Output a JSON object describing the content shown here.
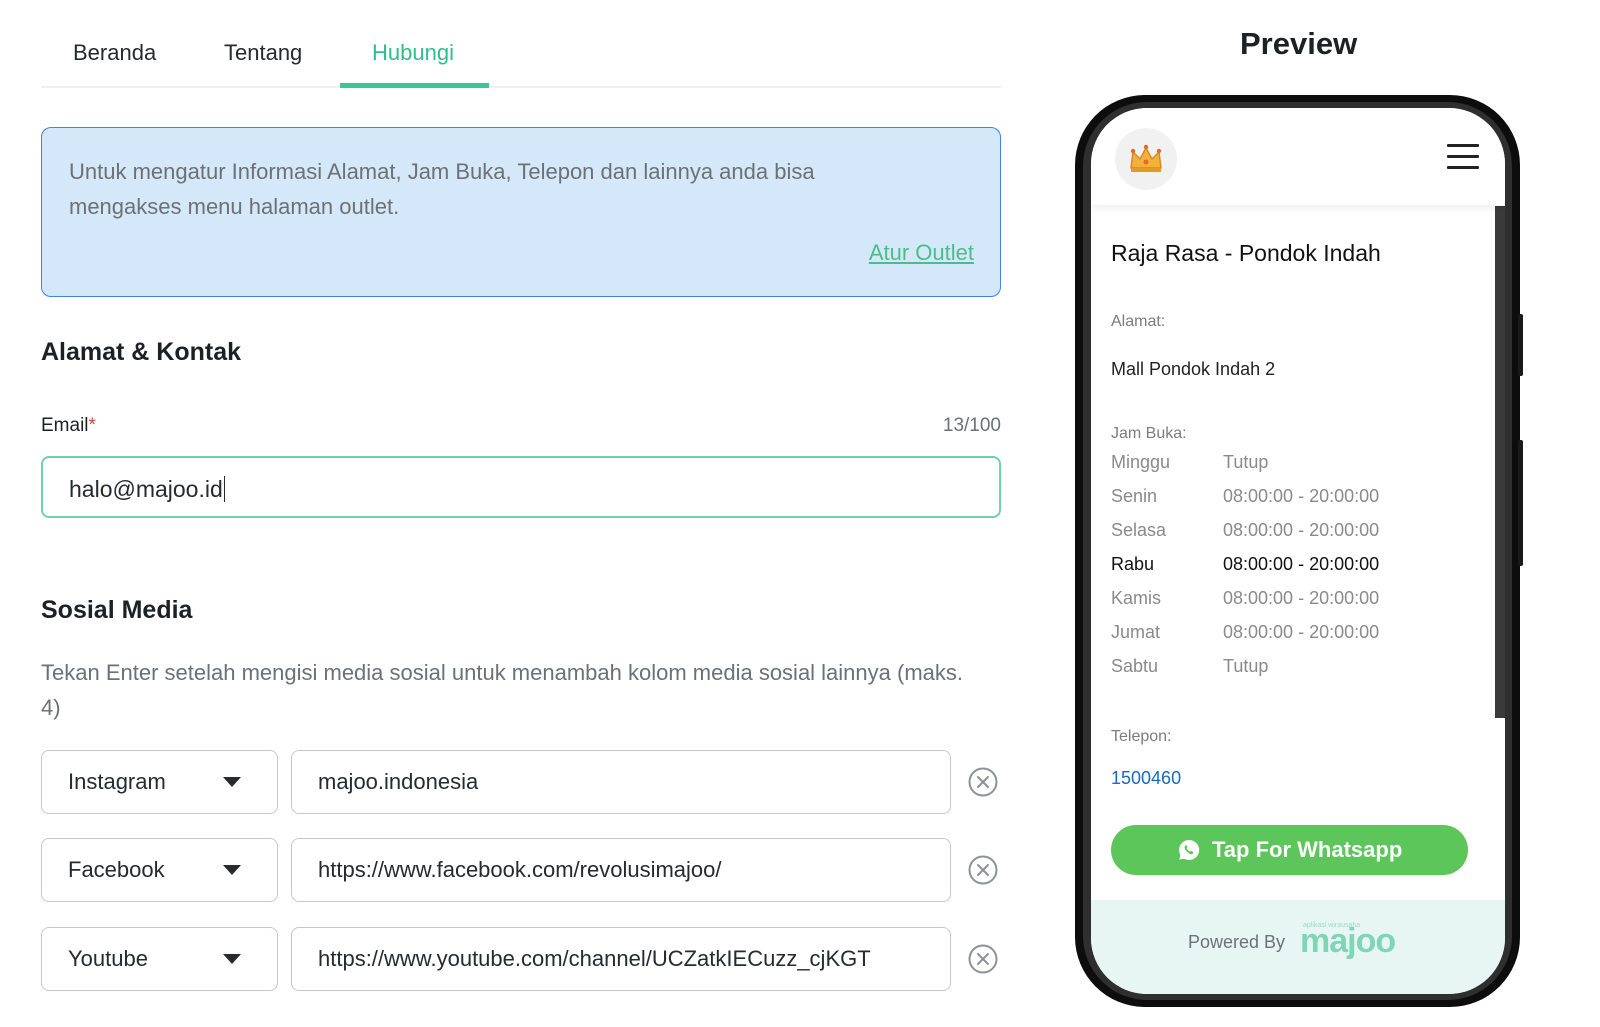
{
  "tabs": [
    {
      "label": "Beranda"
    },
    {
      "label": "Tentang"
    },
    {
      "label": "Hubungi"
    }
  ],
  "info": {
    "text": "Untuk mengatur Informasi Alamat, Jam Buka, Telepon dan lainnya anda bisa mengakses menu halaman outlet.",
    "link": "Atur Outlet"
  },
  "address_section": {
    "title": "Alamat & Kontak",
    "email_label": "Email",
    "required_mark": "*",
    "email_count": "13/100",
    "email_value": "halo@majoo.id"
  },
  "social_section": {
    "title": "Sosial Media",
    "hint": "Tekan Enter setelah mengisi media sosial untuk menambah kolom media sosial lainnya (maks. 4)",
    "rows": [
      {
        "platform": "Instagram",
        "value": "majoo.indonesia"
      },
      {
        "platform": "Facebook",
        "value": "https://www.facebook.com/revolusimajoo/"
      },
      {
        "platform": "Youtube",
        "value": "https://www.youtube.com/channel/UCZatkIECuzz_cjKGT"
      }
    ]
  },
  "preview": {
    "title": "Preview",
    "outlet_name": "Raja Rasa - Pondok Indah",
    "address_label": "Alamat:",
    "address": "Mall Pondok Indah 2",
    "hours_label": "Jam Buka:",
    "hours": [
      {
        "day": "Minggu",
        "time": "Tutup"
      },
      {
        "day": "Senin",
        "time": "08:00:00 - 20:00:00"
      },
      {
        "day": "Selasa",
        "time": "08:00:00 - 20:00:00"
      },
      {
        "day": "Rabu",
        "time": "08:00:00 - 20:00:00"
      },
      {
        "day": "Kamis",
        "time": "08:00:00 - 20:00:00"
      },
      {
        "day": "Jumat",
        "time": "08:00:00 - 20:00:00"
      },
      {
        "day": "Sabtu",
        "time": "Tutup"
      }
    ],
    "phone_label": "Telepon:",
    "phone": "1500460",
    "whatsapp_button": "Tap For Whatsapp",
    "powered_by": "Powered By",
    "brand": "majoo",
    "brand_tagline": "aplikasi wirausaha"
  },
  "colors": {
    "accent": "#3ec496",
    "info_bg": "#d4e8f9",
    "info_border": "#3a86ea",
    "whatsapp": "#5cc65a",
    "link": "#1769c2"
  },
  "icons": [
    "crown-icon",
    "hamburger-menu-icon",
    "whatsapp-icon",
    "remove-circle-icon",
    "dropdown-caret-icon"
  ]
}
